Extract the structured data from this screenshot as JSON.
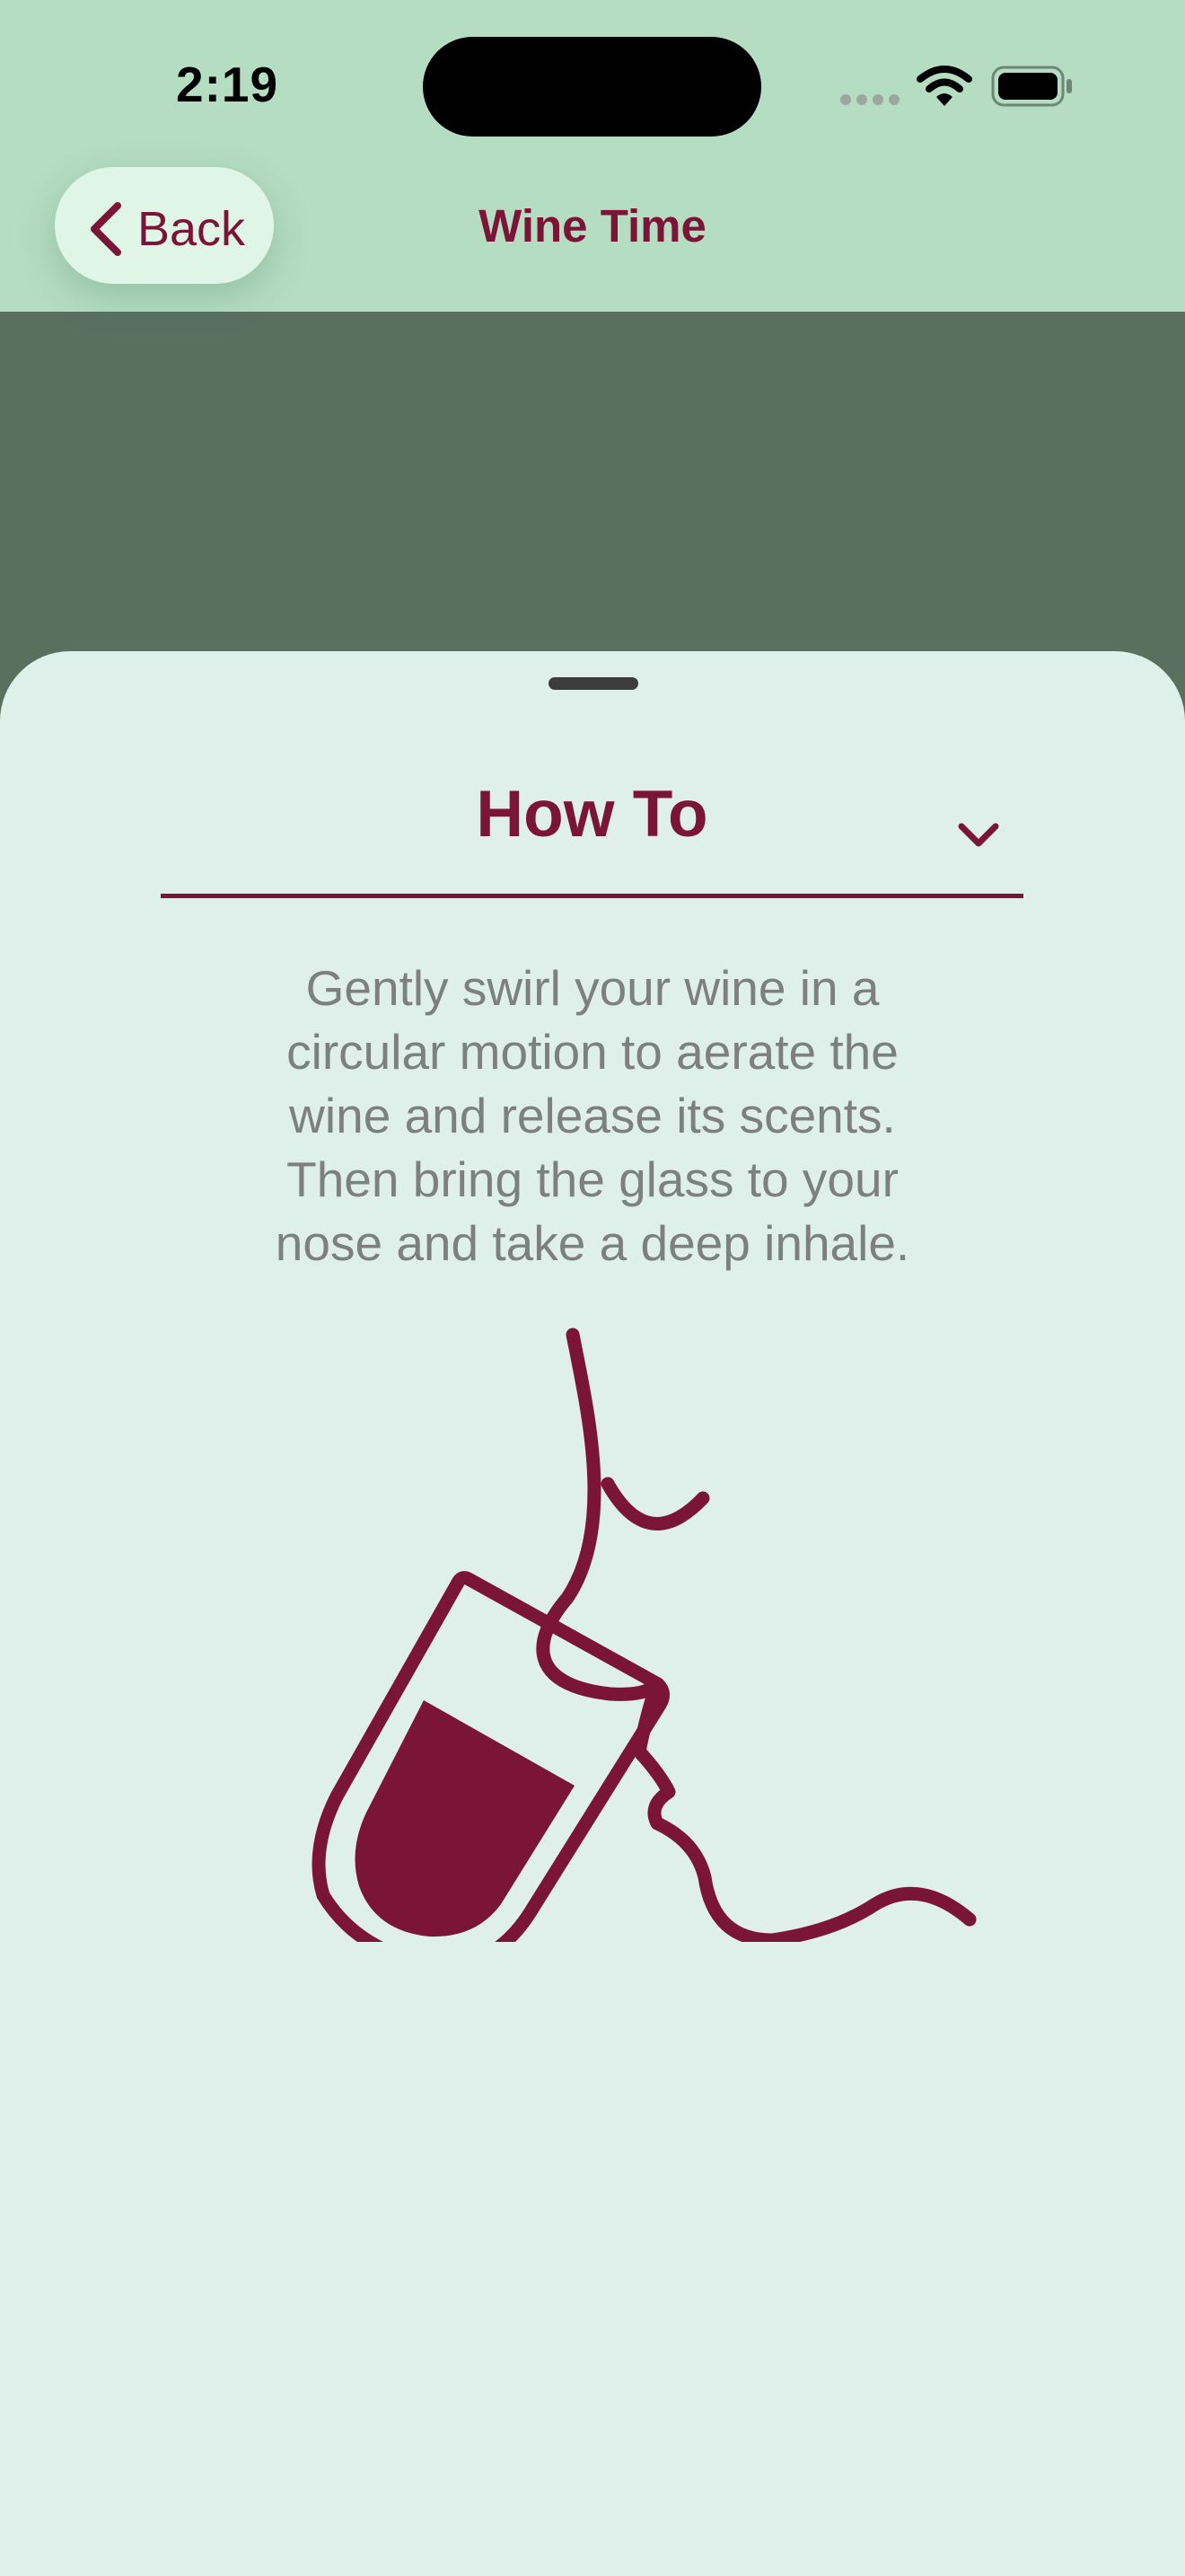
{
  "status_bar": {
    "time": "2:19"
  },
  "nav": {
    "back_label": "Back",
    "title": "Wine Time"
  },
  "section": {
    "title": "How To",
    "description": "Gently swirl your wine in a circular motion to aerate the wine and release its scents. Then bring the glass to your nose and take a deep inhale."
  },
  "colors": {
    "accent": "#7b1538",
    "header_bg": "#b4ddc1",
    "sheet_bg": "#dff0ea",
    "dimmed_bg": "#5b6f5f"
  },
  "icons": [
    "cellular-signal-icon",
    "wifi-icon",
    "battery-icon",
    "chevron-left-icon",
    "chevron-down-icon",
    "wine-swirl-illustration"
  ]
}
